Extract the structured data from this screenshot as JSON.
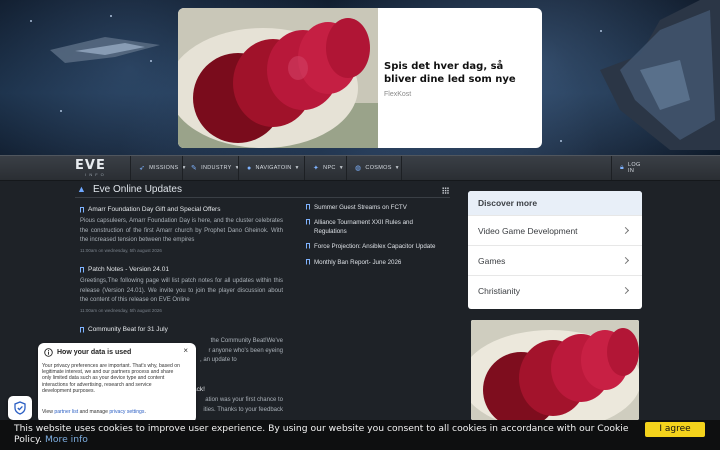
{
  "ad_top": {
    "title": "Spis det hver dag, så bliver dine led som nye",
    "source": "FlexKost"
  },
  "nav": {
    "logo": "EVE",
    "logo_sub": "INFO",
    "items": [
      {
        "label": "MISSIONS",
        "icon": "rocket-icon"
      },
      {
        "label": "INDUSTRY",
        "icon": "wrench-icon"
      },
      {
        "label": "NAVIGATOIN",
        "icon": "map-pin-icon"
      },
      {
        "label": "NPC",
        "icon": "pin-icon"
      },
      {
        "label": "COSMOS",
        "icon": "globe-icon"
      }
    ],
    "login": "LOG IN"
  },
  "main": {
    "title": "Eve Online Updates",
    "articles": [
      {
        "title": "Amarr Foundation Day Gift and Special Offers",
        "body": "Pious capsuleers, Amarr Foundation Day is here, and the cluster celebrates the construction of the first Amarr church by Prophet Dano Gheinok. With the increased tension between the empires",
        "date": "11:00am on wednesday, 5th august 2026"
      },
      {
        "title": "Patch Notes - Version 24.01",
        "body": "Greetings,The following page will list patch notes for all updates within this release (Version 24.01). We invite you to join the player discussion about the content of this release on EVE Online",
        "date": "11:00am on wednesday, 5th august 2026"
      },
      {
        "title": "Community Beat for 31 July",
        "body_lines": [
          "the Community Beat!We've",
          "r anyone who's been eyeing",
          ", an update to"
        ]
      },
      {
        "title_fragment": "ack!",
        "body_lines": [
          "ation was your first chance to",
          "ities. Thanks to your feedback"
        ]
      }
    ],
    "side_links": [
      "Summer Guest Streams on FCTV",
      "Alliance Tournament XXII Rules and Regulations",
      "Force Projection: Ansiblex Capacitor Update",
      "Monthly Ban Report- June 2026"
    ]
  },
  "discover": {
    "title": "Discover more",
    "items": [
      "Video Game Development",
      "Games",
      "Christianity"
    ]
  },
  "privacy": {
    "title": "How your data is used",
    "close": "×",
    "body": "Your privacy preferences are important. That's why, based on legitimate interest, we and our partners process and share only limited data such as your device type and content interactions for advertising, research and service development purposes.",
    "foot_pre": "View",
    "partner_link": "partner list",
    "foot_mid": "and manage",
    "settings_link": "privacy settings",
    "foot_end": "."
  },
  "cookie": {
    "text": "This website uses cookies to improve user experience. By using our website you consent to all cookies in accordance with our Cookie Policy.",
    "more": "More info",
    "accept": "I agree"
  },
  "colors": {
    "accent": "#7fb3ff",
    "cookie_button": "#f3d21c"
  }
}
